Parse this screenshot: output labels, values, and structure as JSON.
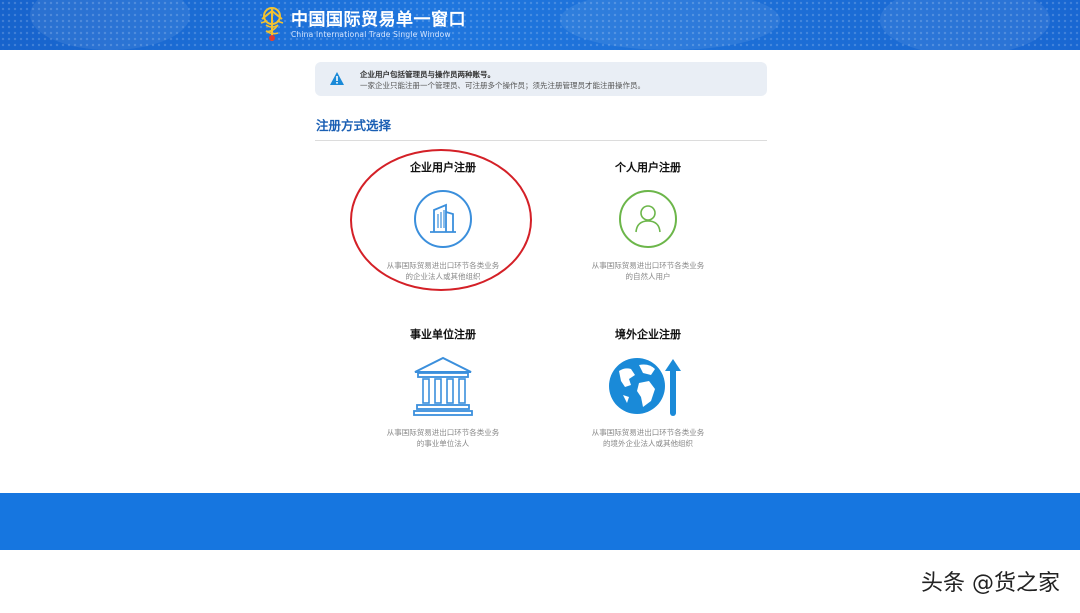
{
  "header": {
    "logo_cn": "中国国际贸易单一窗口",
    "logo_en": "China International Trade Single Window",
    "bg_color": "#1a6fd8"
  },
  "notice": {
    "icon": "warning-triangle-icon",
    "line1": "企业用户包括管理员与操作员两种账号。",
    "line2": "一家企业只能注册一个管理员、可注册多个操作员；须先注册管理员才能注册操作员。"
  },
  "section": {
    "title": "注册方式选择"
  },
  "options": [
    {
      "title": "企业用户注册",
      "icon": "building-icon",
      "desc1": "从事国际贸易进出口环节各类业务",
      "desc2": "的企业法人或其他组织"
    },
    {
      "title": "个人用户注册",
      "icon": "person-icon",
      "desc1": "从事国际贸易进出口环节各类业务",
      "desc2": "的自然人用户"
    },
    {
      "title": "事业单位注册",
      "icon": "institution-icon",
      "desc1": "从事国际贸易进出口环节各类业务",
      "desc2": "的事业单位法人"
    },
    {
      "title": "境外企业注册",
      "icon": "globe-icon",
      "desc1": "从事国际贸易进出口环节各类业务",
      "desc2": "的境外企业法人或其他组织"
    }
  ],
  "watermark": "头条 @货之家",
  "colors": {
    "accent": "#1a5fb4",
    "enterprise_icon": "#3b8fdc",
    "personal_icon": "#6cb64a",
    "institution_icon": "#3b8fdc",
    "globe_icon": "#1a8ad8",
    "highlight": "#d42027",
    "footer": "#1676e0"
  }
}
